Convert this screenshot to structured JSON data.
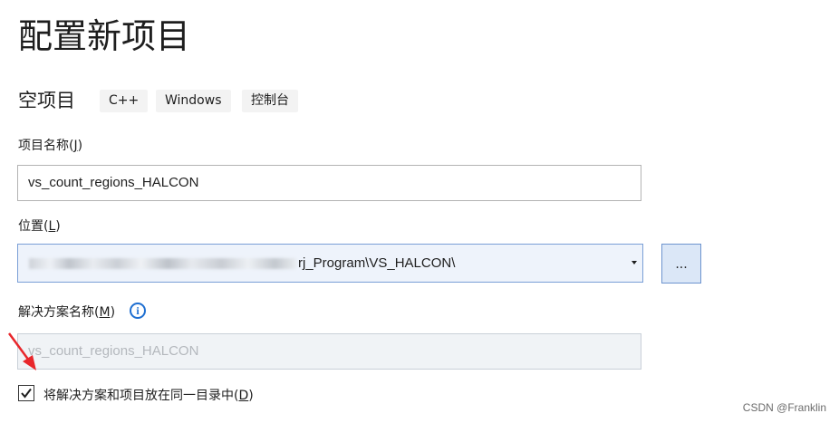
{
  "page": {
    "title": "配置新项目",
    "template_name": "空项目",
    "tags": [
      "C++",
      "Windows",
      "控制台"
    ]
  },
  "project_name": {
    "label": "项目名称(",
    "label_key": "J",
    "label_end": ")",
    "value": "vs_count_regions_HALCON"
  },
  "location": {
    "label": "位置(",
    "label_key": "L",
    "label_end": ")",
    "value_visible": "rj_Program\\VS_HALCON\\",
    "browse_label": "..."
  },
  "solution_name": {
    "label": "解决方案名称(",
    "label_key": "M",
    "label_end": ")",
    "info_icon": "i",
    "value": "vs_count_regions_HALCON"
  },
  "same_dir": {
    "checked": true,
    "label": "将解决方案和项目放在同一目录中(",
    "label_key": "D",
    "label_end": ")"
  },
  "watermark": "CSDN @Franklin",
  "colors": {
    "accent": "#1f6fd1",
    "arrow": "#e8262b"
  }
}
